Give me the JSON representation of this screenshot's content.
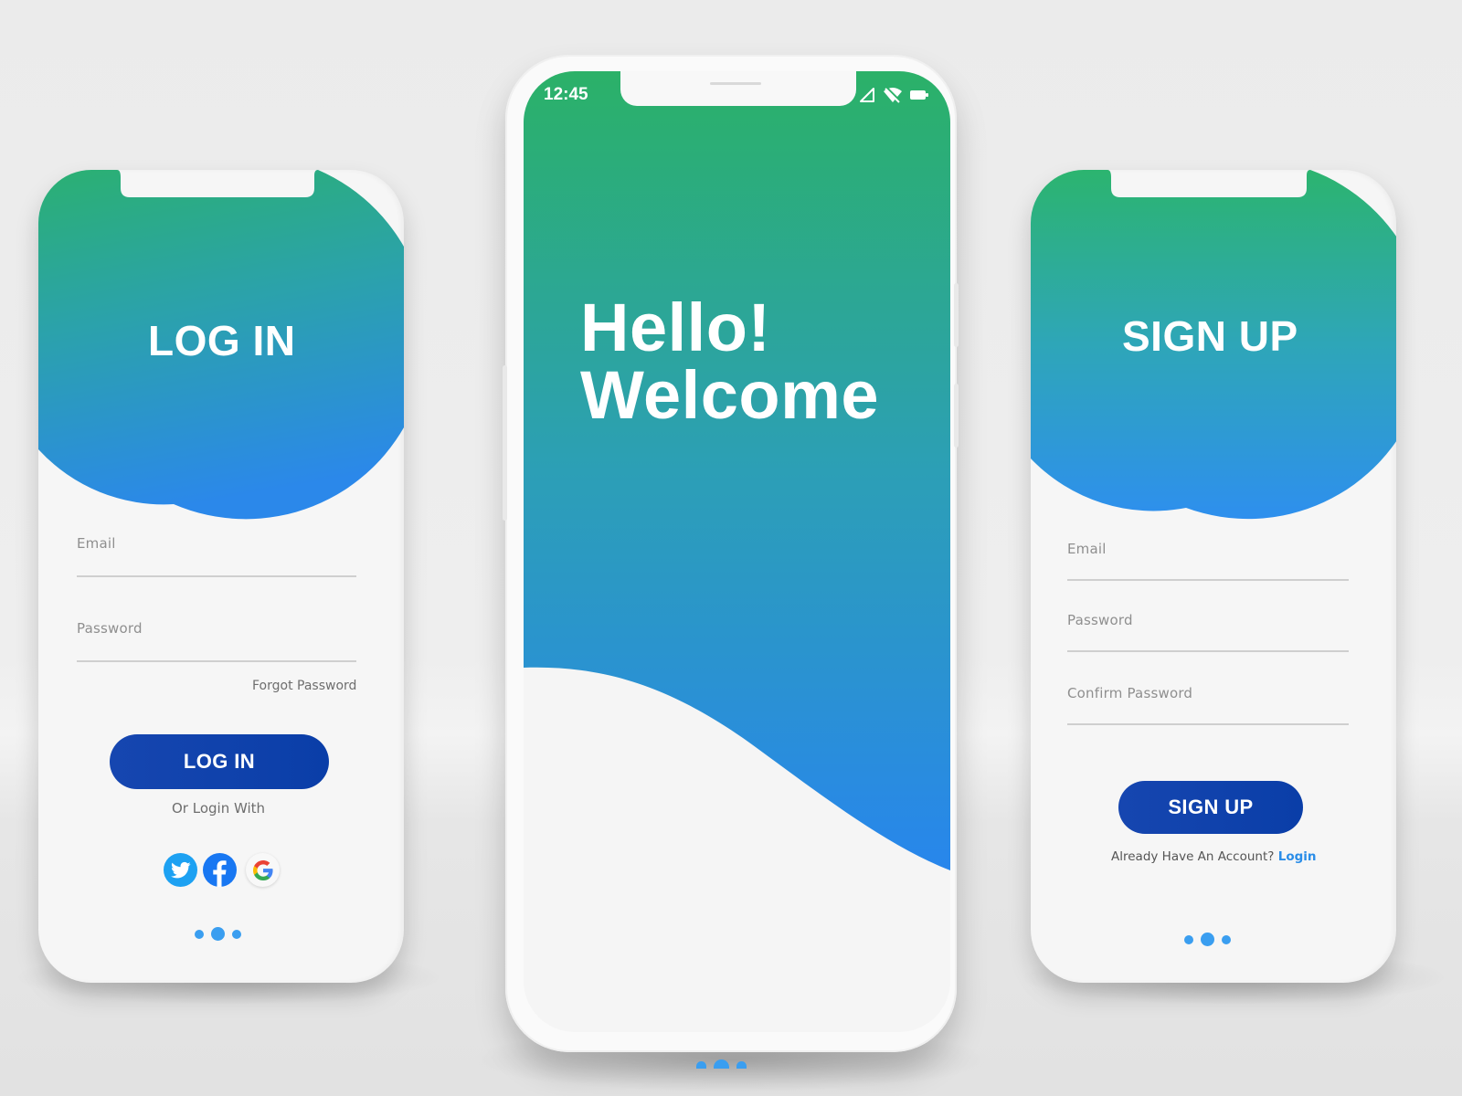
{
  "colors": {
    "gradient_top": "#2bb16b",
    "gradient_bottom": "#2b87ea",
    "button_blue": "#1043ad",
    "dot_blue": "#3a9ef0",
    "link_blue": "#2a8de8",
    "label_gray": "#8f8f8f"
  },
  "welcome_screen": {
    "status_bar": {
      "time": "12:45",
      "icons": [
        "signal-icon",
        "wifi-off-icon",
        "battery-icon"
      ]
    },
    "headline_line1": "Hello!",
    "headline_line2": "Welcome",
    "page_indicator": {
      "count": 3,
      "active_index": 1
    }
  },
  "login_screen": {
    "title": "LOG IN",
    "fields": [
      {
        "label": "Email",
        "value": ""
      },
      {
        "label": "Password",
        "value": ""
      }
    ],
    "forgot_password": "Forgot Password",
    "submit_label": "LOG IN",
    "alt_login_text": "Or Login With",
    "social_providers": [
      "twitter-icon",
      "facebook-icon",
      "google-icon"
    ],
    "page_indicator": {
      "count": 3,
      "active_index": 1
    }
  },
  "signup_screen": {
    "title": "SIGN UP",
    "fields": [
      {
        "label": "Email",
        "value": ""
      },
      {
        "label": "Password",
        "value": ""
      },
      {
        "label": "Confirm Password",
        "value": ""
      }
    ],
    "submit_label": "SIGN UP",
    "have_account_text": "Already Have An Account?",
    "login_link": "Login",
    "page_indicator": {
      "count": 3,
      "active_index": 1
    }
  }
}
